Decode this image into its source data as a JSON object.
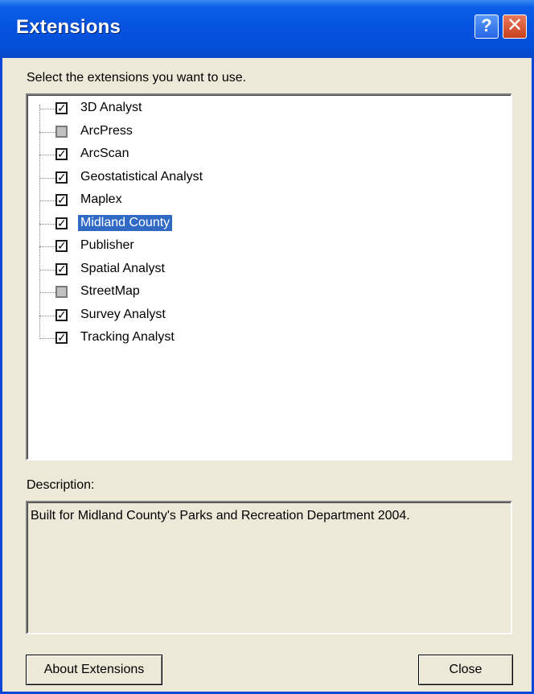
{
  "window": {
    "title": "Extensions",
    "help_glyph": "?",
    "close_glyph": "✕"
  },
  "prompt": "Select the extensions you want to use.",
  "extensions": [
    {
      "label": "3D Analyst",
      "checked": true
    },
    {
      "label": "ArcPress",
      "checked": false
    },
    {
      "label": "ArcScan",
      "checked": true
    },
    {
      "label": "Geostatistical Analyst",
      "checked": true
    },
    {
      "label": "Maplex",
      "checked": true
    },
    {
      "label": "Midland County",
      "checked": true,
      "selected": true
    },
    {
      "label": "Publisher",
      "checked": true
    },
    {
      "label": "Spatial Analyst",
      "checked": true
    },
    {
      "label": "StreetMap",
      "checked": false
    },
    {
      "label": "Survey Analyst",
      "checked": true
    },
    {
      "label": "Tracking Analyst",
      "checked": true
    }
  ],
  "description": {
    "label": "Description:",
    "text": "Built for Midland County's Parks and Recreation Department 2004."
  },
  "buttons": {
    "about": "About Extensions",
    "close": "Close"
  },
  "colors": {
    "titlebar": "#0553e0",
    "selection": "#316ac5",
    "dialog_bg": "#ece9d8"
  }
}
